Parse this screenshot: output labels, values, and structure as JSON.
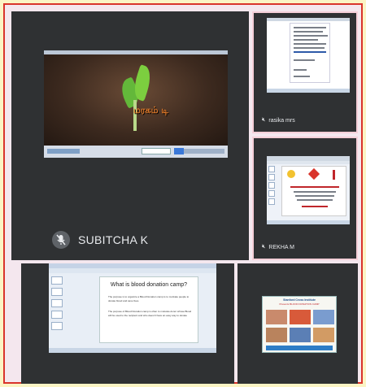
{
  "tiles": {
    "main": {
      "name": "SUBITCHA K",
      "slide_title": "மரகம் டி"
    },
    "top_right": {
      "name": "rasika mrs"
    },
    "mid_right": {
      "name": "REKHA M"
    },
    "bottom_left": {
      "slide_title": "What is blood donation camp?",
      "bullets": [
        "The purpose is to organize a Blood Donation camp is to motivate people to donate blood and save lives.",
        "The purpose of Blood Donation camp is often to motivate donor whose Blood will be used to the recipient and who doesn't have an easy way to donate"
      ]
    },
    "bottom_right": {
      "poster_title": "Stanford Cross Institute",
      "poster_sub": "Presents BLOOD DONATION CAMP"
    }
  },
  "icons": {
    "mic_off": "mic-off-icon"
  },
  "colors": {
    "tile_bg": "#2f3133",
    "outer_border": "#d9342b",
    "page_bg": "#fbf4c4"
  }
}
